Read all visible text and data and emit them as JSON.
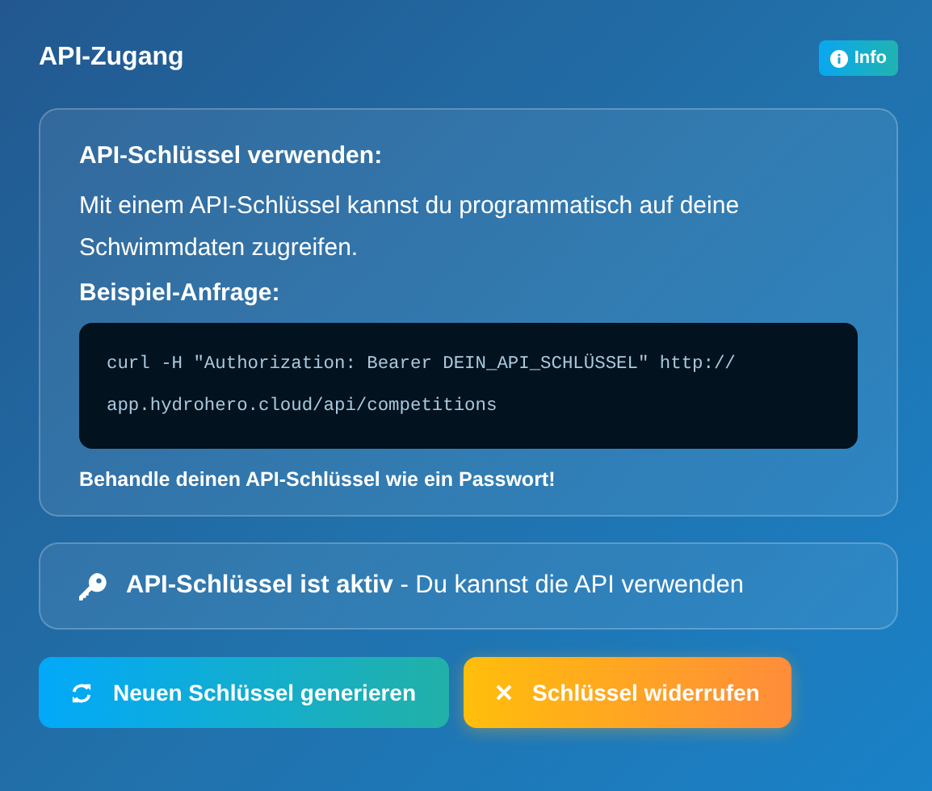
{
  "title": "API-Zugang",
  "info_button": {
    "label": "Info"
  },
  "usage_card": {
    "heading": "API-Schlüssel verwenden:",
    "description": "Mit einem API-Schlüssel kannst du programmatisch auf deine Schwimmdaten zugreifen.",
    "example_heading": "Beispiel-Anfrage:",
    "code_lines": [
      "curl -H \"Authorization: Bearer DEIN_API_SCHLÜSSEL\" http://",
      "app.hydrohero.cloud/api/competitions"
    ],
    "warning": "Behandle deinen API-Schlüssel wie ein Passwort!"
  },
  "status": {
    "text": "**API-Schlüssel ist aktiv** - Du kannst die API verwenden"
  },
  "buttons": [
    {
      "kind": "generate",
      "label": "Neuen Schlüssel generieren"
    },
    {
      "kind": "revoke",
      "label": "Schlüssel widerrufen"
    }
  ]
}
